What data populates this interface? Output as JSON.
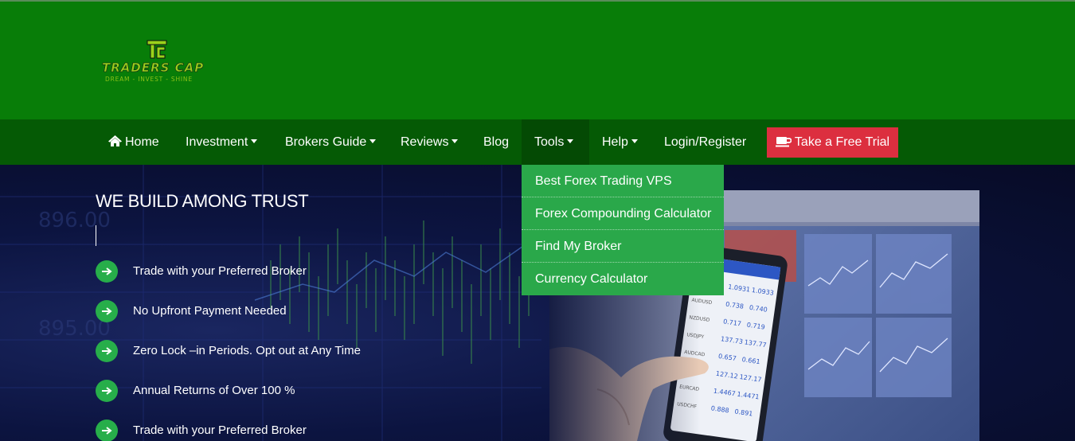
{
  "brand": {
    "name": "TRADERS CAP",
    "tagline": "DREAM - INVEST - SHINE"
  },
  "nav": {
    "home": "Home",
    "investment": "Investment",
    "brokers_guide": "Brokers Guide",
    "reviews": "Reviews",
    "blog": "Blog",
    "tools": "Tools",
    "help": "Help",
    "login": "Login/Register",
    "trial": "Take a Free Trial"
  },
  "tools_menu": [
    "Best Forex Trading VPS",
    "Forex Compounding Calculator",
    "Find My Broker",
    "Currency Calculator"
  ],
  "hero": {
    "title": "WE BUILD AMONG TRUST",
    "features": [
      "Trade with your Preferred Broker",
      "No Upfront Payment Needed",
      "Zero Lock –in Periods. Opt out at Any Time",
      "Annual Returns of Over 100 %",
      "Trade with your Preferred Broker"
    ]
  },
  "colors": {
    "header_green": "#087d08",
    "nav_green": "#055a05",
    "dropdown_green": "#2aa84a",
    "trial_red": "#dc2f3f",
    "check_green": "#27ae4a"
  }
}
